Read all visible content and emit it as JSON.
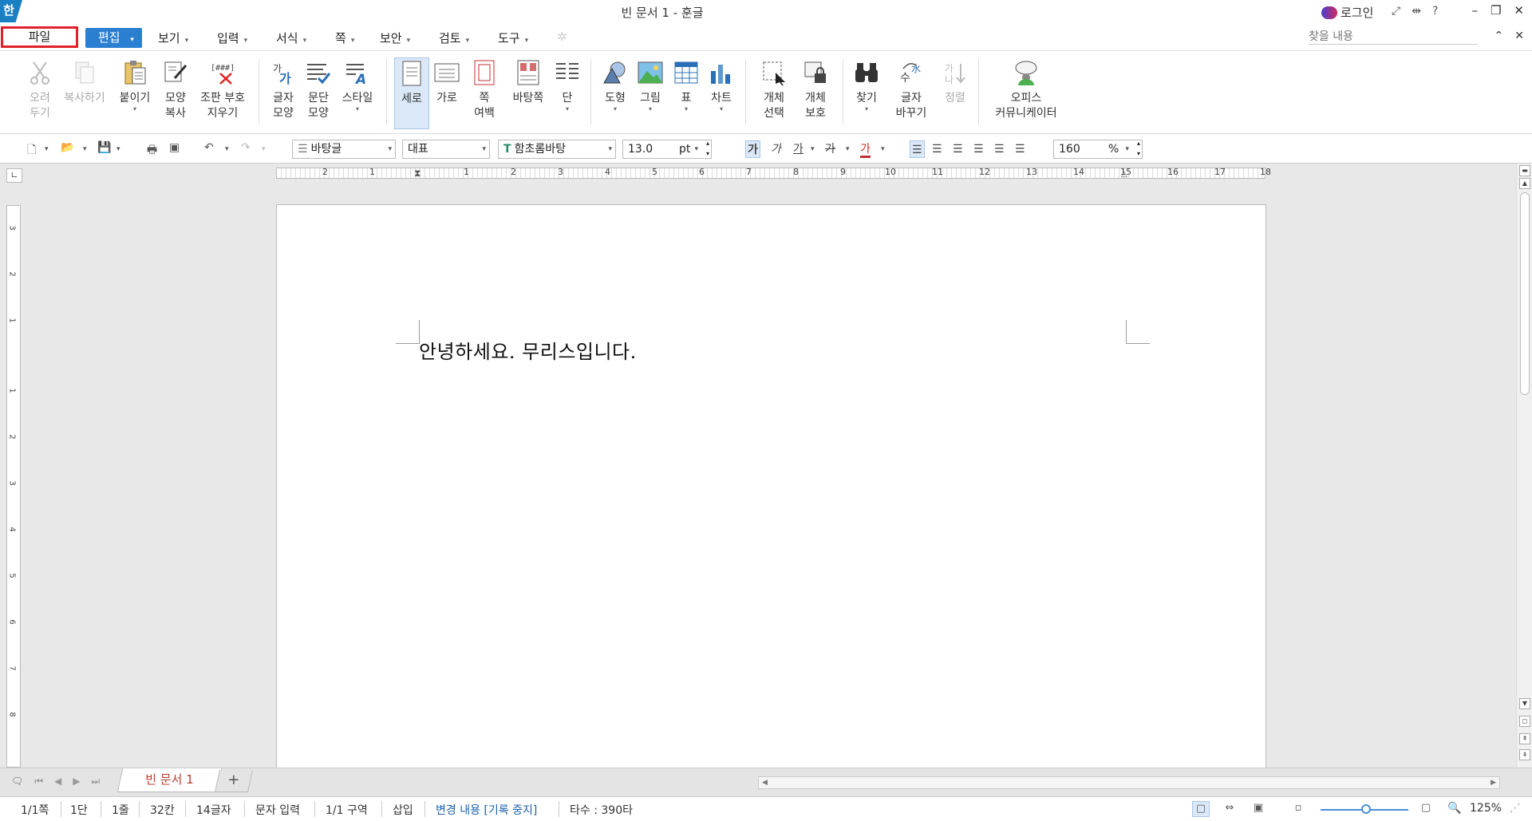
{
  "window": {
    "app_logo": "한",
    "title": "빈 문서 1 - 훈글",
    "login_label": "로그인",
    "controls": [
      "–",
      "❐",
      "✕"
    ]
  },
  "menubar": {
    "file": "파일",
    "edit": "편집",
    "items": [
      "보기",
      "입력",
      "서식",
      "쪽",
      "보안",
      "검토",
      "도구"
    ],
    "search_placeholder": "찾을 내용"
  },
  "ribbon": {
    "cut": [
      "오려",
      "두기"
    ],
    "copy": "복사하기",
    "paste": "붙이기",
    "format_copy": [
      "모양",
      "복사"
    ],
    "clear_marks": [
      "조판 부호",
      "지우기"
    ],
    "char_shape": [
      "글자",
      "모양"
    ],
    "para_shape": [
      "문단",
      "모양"
    ],
    "style": "스타일",
    "portrait": "세로",
    "landscape": "가로",
    "page_margin": [
      "쪽",
      "여백"
    ],
    "background": "바탕쪽",
    "columns": "단",
    "shape": "도형",
    "picture": "그림",
    "table": "표",
    "chart": "차트",
    "select_obj": [
      "개체",
      "선택"
    ],
    "protect_obj": [
      "개체",
      "보호"
    ],
    "find": "찾기",
    "replace": [
      "글자",
      "바꾸기"
    ],
    "sort": "정렬",
    "office": [
      "오피스",
      "커뮤니케이터"
    ]
  },
  "toolbar": {
    "style_combo": "바탕글",
    "lang_combo": "대표",
    "font_combo": "함초롬바탕",
    "font_size": "13.0",
    "size_unit": "pt",
    "zoom_value": "160",
    "zoom_unit": "%",
    "fmt_labels": [
      "가",
      "가",
      "가",
      "가",
      "가"
    ]
  },
  "ruler": {
    "h_numbers": [
      "2",
      "1",
      "1",
      "2",
      "3",
      "4",
      "5",
      "6",
      "7",
      "8",
      "9",
      "10",
      "11",
      "12",
      "13",
      "14",
      "15",
      "16",
      "17",
      "18"
    ],
    "v_numbers": [
      "3",
      "2",
      "1",
      "1",
      "2",
      "3",
      "4",
      "5",
      "6",
      "7",
      "8"
    ]
  },
  "document": {
    "body_text": "안녕하세요.  무리스입니다."
  },
  "tabs": {
    "doc_tab": "빈 문서 1",
    "add": "+"
  },
  "status": {
    "page": "1/1쪽",
    "column": "1단",
    "line": "1줄",
    "col_pos": "32칸",
    "chars": "14글자",
    "input_mode": "문자 입력",
    "section": "1/1 구역",
    "insert": "삽입",
    "change_tracking": "변경 내용 [기록 중지]",
    "typing": "타수 : 390타",
    "zoom": "125%"
  },
  "colors": {
    "accent": "#2a7fd0",
    "file_highlight": "#e0202a",
    "tab_text": "#c0392b"
  }
}
